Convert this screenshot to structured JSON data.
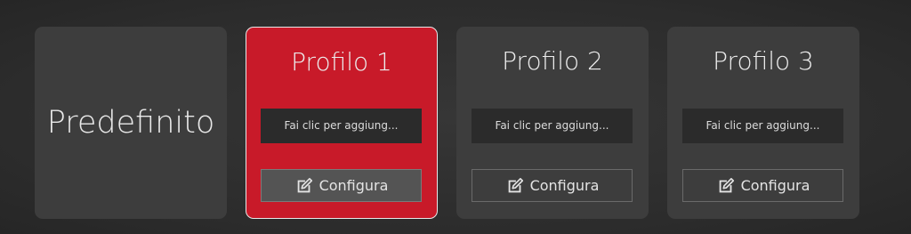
{
  "profiles": {
    "default": {
      "label": "Predefinito"
    },
    "items": [
      {
        "title": "Profilo 1",
        "description": "Fai clic per aggiung...",
        "configure_label": "Configura",
        "active": true,
        "icon": "edit-icon"
      },
      {
        "title": "Profilo 2",
        "description": "Fai clic per aggiung...",
        "configure_label": "Configura",
        "active": false,
        "icon": "edit-icon"
      },
      {
        "title": "Profilo 3",
        "description": "Fai clic per aggiung...",
        "configure_label": "Configura",
        "active": false,
        "icon": "edit-icon"
      }
    ]
  },
  "colors": {
    "background": "#2f2f2f",
    "card": "#3d3d3d",
    "active_card": "#c81a29",
    "description_box": "#2b2b2b",
    "text": "#ececec"
  }
}
